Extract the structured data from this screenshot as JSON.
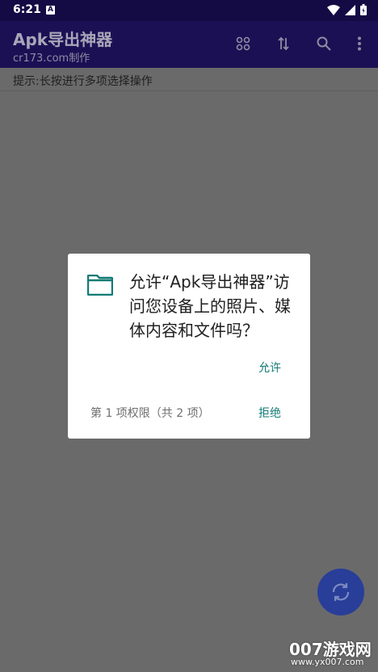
{
  "status_bar": {
    "time": "6:21",
    "notif_letter": "A"
  },
  "app_bar": {
    "title": "Apk导出神器",
    "subtitle": "cr173.com制作",
    "icons": [
      "apps-icon",
      "sort-icon",
      "search-icon",
      "more-vert-icon"
    ]
  },
  "hint": {
    "text": "提示:长按进行多项选择操作"
  },
  "dialog": {
    "icon": "folder-icon",
    "message": "允许“Apk导出神器”访问您设备上的照片、媒体内容和文件吗？",
    "allow_label": "允许",
    "permission_count": "第 1 项权限（共 2 项）",
    "deny_label": "拒绝"
  },
  "fab": {
    "icon": "refresh-icon"
  },
  "watermark": {
    "brand": "007游戏网",
    "url": "www.yx007.com"
  },
  "colors": {
    "status_bar": "#140a44",
    "app_bar": "#1c1055",
    "scrim_bg": "#6a6a6a",
    "accent_teal": "#137b75",
    "fab": "#283e98"
  }
}
